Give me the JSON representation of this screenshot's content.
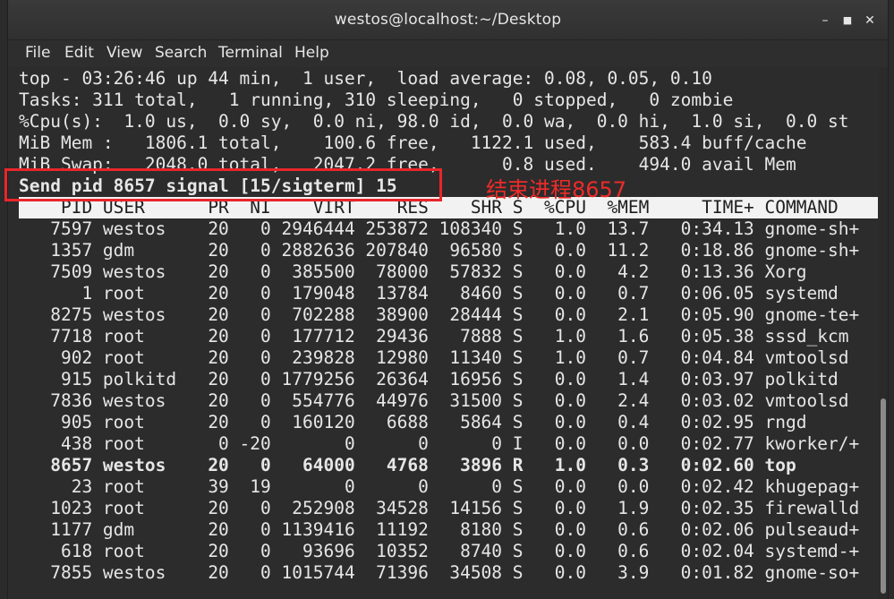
{
  "window": {
    "title": "westos@localhost:~/Desktop",
    "minimize_icon": "minimize-icon",
    "maximize_icon": "maximize-icon",
    "close_icon": "close-icon"
  },
  "menu": [
    "File",
    "Edit",
    "View",
    "Search",
    "Terminal",
    "Help"
  ],
  "summary": {
    "top": "top - 03:26:46 up 44 min,  1 user,  load average: 0.08, 0.05, 0.10",
    "tasks": "Tasks: 311 total,   1 running, 310 sleeping,   0 stopped,   0 zombie",
    "cpu": "%Cpu(s):  1.0 us,  0.0 sy,  0.0 ni, 98.0 id,  0.0 wa,  0.0 hi,  1.0 si,  0.0 st",
    "mem": "MiB Mem :   1806.1 total,    100.6 free,   1122.1 used,    583.4 buff/cache",
    "swap": "MiB Swap:   2048.0 total,   2047.2 free,      0.8 used.    494.0 avail Mem"
  },
  "prompt": "Send pid 8657 signal [15/sigterm] 15",
  "annotation": "结束进程8657",
  "columns": "    PID USER      PR  NI    VIRT    RES    SHR S  %CPU  %MEM     TIME+ COMMAND",
  "rows": [
    "   7597 westos    20   0 2946444 253872 108340 S   1.0  13.7   0:34.13 gnome-sh+",
    "   1357 gdm       20   0 2882636 207840  96580 S   0.0  11.2   0:18.86 gnome-sh+",
    "   7509 westos    20   0  385500  78000  57832 S   0.0   4.2   0:13.36 Xorg",
    "      1 root      20   0  179048  13784   8460 S   0.0   0.7   0:06.05 systemd",
    "   8275 westos    20   0  702288  38900  28444 S   0.0   2.1   0:05.90 gnome-te+",
    "   7718 root      20   0  177712  29436   7888 S   1.0   1.6   0:05.38 sssd_kcm",
    "    902 root      20   0  239828  12980  11340 S   1.0   0.7   0:04.84 vmtoolsd",
    "    915 polkitd   20   0 1779256  26364  16956 S   0.0   1.4   0:03.97 polkitd",
    "   7836 westos    20   0  554776  44976  31500 S   0.0   2.4   0:03.02 vmtoolsd",
    "    905 root      20   0  160120   6688   5864 S   0.0   0.4   0:02.95 rngd",
    "    438 root       0 -20       0      0      0 I   0.0   0.0   0:02.77 kworker/+",
    "   8657 westos    20   0   64000   4768   3896 R   1.0   0.3   0:02.60 top",
    "     23 root      39  19       0      0      0 S   0.0   0.0   0:02.42 khugepag+",
    "   1023 root      20   0  252908  34528  14156 S   0.0   1.9   0:02.35 firewalld",
    "   1177 gdm       20   0 1139416  11192   8180 S   0.0   0.6   0:02.06 pulseaud+",
    "    618 root      20   0   93696  10352   8740 S   0.0   0.6   0:02.04 systemd-+",
    "   7855 westos    20   0 1015744  71396  34508 S   0.0   3.9   0:01.82 gnome-so+"
  ],
  "colors": {
    "highlight_border": "#e8262b",
    "annotation": "#ee2a2a",
    "terminal_bg": "#2c2c2c",
    "terminal_fg": "#e6e6e6"
  }
}
